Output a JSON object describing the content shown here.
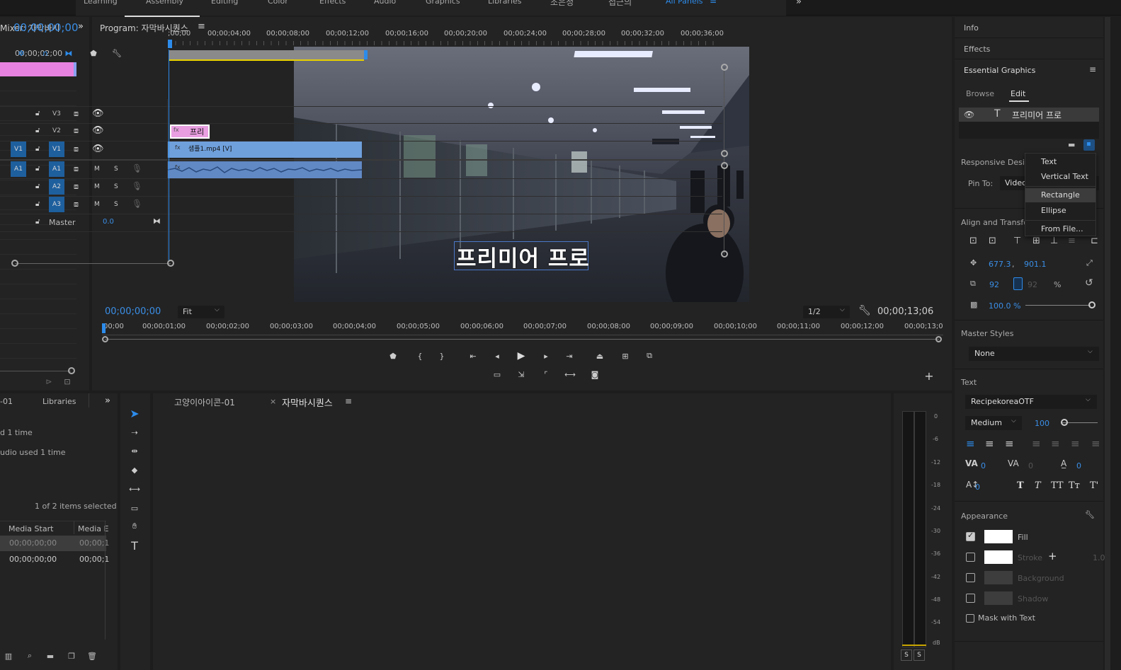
{
  "workspaces": {
    "items": [
      "Learning",
      "Assembly",
      "Editing",
      "Color",
      "Effects",
      "Audio",
      "Graphics",
      "Libraries",
      "조은정",
      "접근의",
      "All Panels"
    ]
  },
  "mixer": {
    "title": "Mixer: 자막바시",
    "timecode": "00;00;02;00"
  },
  "program": {
    "title": "Program: 자막바시퀀스",
    "overlay_text": "프리미어 프로",
    "current_time": "00;00;00;00",
    "fit": "Fit",
    "resolution": "1/2",
    "duration": "00;00;13;06",
    "ruler": [
      "00;00",
      "00;00;01;00",
      "00;00;02;00",
      "00;00;03;00",
      "00;00;04;00",
      "00;00;05;00",
      "00;00;06;00",
      "00;00;07;00",
      "00;00;08;00",
      "00;00;09;00",
      "00;00;10;00",
      "00;00;11;00",
      "00;00;12;00",
      "00;00;13;0"
    ]
  },
  "project": {
    "tabs": [
      "-01",
      "Libraries"
    ],
    "used1": "d 1 time",
    "used2": "udio used 1 time",
    "selected": "1 of 2 items selected",
    "col_media_start": "Media Start",
    "col_media_end": "Media E",
    "rows": [
      {
        "start": "00;00;00;00",
        "end": "00;00;1"
      },
      {
        "start": "00;00;00;00",
        "end": "00;00;1"
      }
    ]
  },
  "timeline": {
    "tabs": [
      "고양이아이콘-01",
      "자막바시퀀스"
    ],
    "close_mark": "×",
    "timecode": "00;00;00;00",
    "ruler": [
      ";00;00",
      "00;00;04;00",
      "00;00;08;00",
      "00;00;12;00",
      "00;00;16;00",
      "00;00;20;00",
      "00;00;24;00",
      "00;00;28;00",
      "00;00;32;00",
      "00;00;36;00"
    ],
    "video_tracks": [
      {
        "label": "V3",
        "src": ""
      },
      {
        "label": "V2",
        "src": ""
      },
      {
        "label": "V1",
        "src": "V1"
      }
    ],
    "audio_tracks": [
      {
        "label": "A1",
        "src": "A1"
      },
      {
        "label": "A2",
        "src": ""
      },
      {
        "label": "A3",
        "src": ""
      }
    ],
    "m_label": "M",
    "s_label": "S",
    "master_label": "Master",
    "master_value": "0.0",
    "clip_title": "프리",
    "clip_video": "샘플1.mp4 [V]"
  },
  "meter": {
    "scale": [
      "0",
      "-6",
      "-12",
      "-18",
      "-24",
      "-30",
      "-36",
      "-42",
      "-48",
      "-54",
      "dB"
    ],
    "solo": [
      "S",
      "S"
    ]
  },
  "right_panel": {
    "info": "Info",
    "effects": "Effects",
    "eg_title": "Essential Graphics",
    "tab_browse": "Browse",
    "tab_edit": "Edit",
    "layer_name": "프리미어 프로",
    "responsive": "Responsive Design",
    "pin_to": "Pin To:",
    "pin_value": "Video",
    "align": "Align and Transform",
    "pos_x": "677.3",
    "pos_comma": ",",
    "pos_y": "901.1",
    "scale_w": "92",
    "scale_h": "92",
    "percent": "%",
    "opacity": "100.0 %",
    "master_styles": "Master Styles",
    "master_style_value": "None",
    "text_section": "Text",
    "font": "RecipekoreaOTF",
    "weight": "Medium",
    "size": "100",
    "kerning": "0",
    "tracking": "0",
    "leading": "0",
    "baseline": "0",
    "appearance": "Appearance",
    "fill": "Fill",
    "stroke": "Stroke",
    "stroke_val": "1.0",
    "background": "Background",
    "shadow": "Shadow",
    "mask": "Mask with Text"
  },
  "dropdown": {
    "items": [
      "Text",
      "Vertical Text",
      "Rectangle",
      "Ellipse",
      "From File..."
    ]
  }
}
